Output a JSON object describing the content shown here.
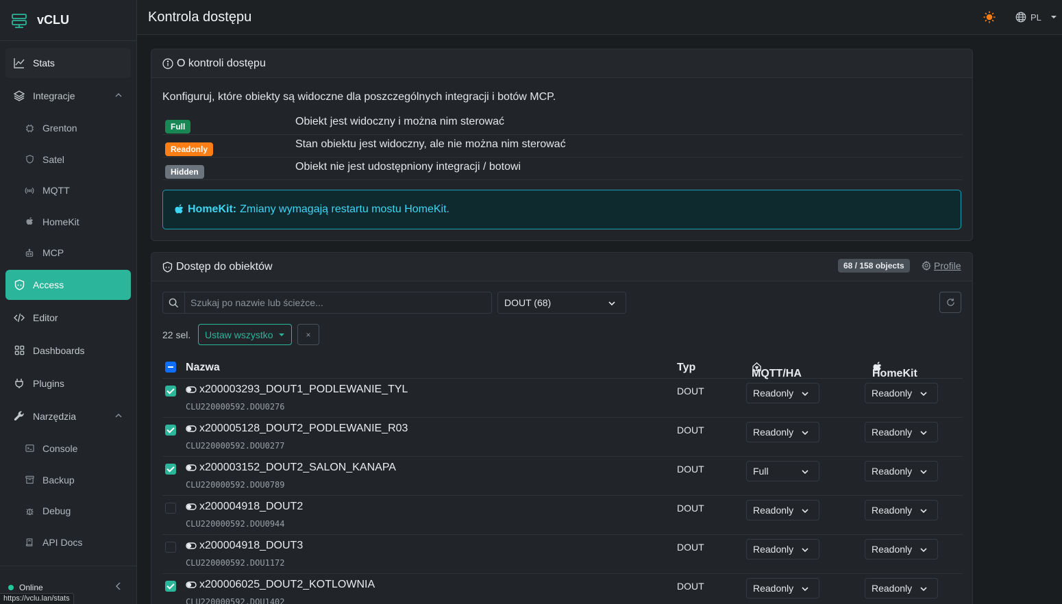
{
  "app": {
    "name": "vCLU"
  },
  "header": {
    "title": "Kontrola dostępu",
    "language": "PL"
  },
  "sidebar": {
    "stats": "Stats",
    "integrations": {
      "label": "Integracje",
      "items": [
        "Grenton",
        "Satel",
        "MQTT",
        "HomeKit",
        "MCP"
      ]
    },
    "access": "Access",
    "editor": "Editor",
    "dashboards": "Dashboards",
    "plugins": "Plugins",
    "tools": {
      "label": "Narzędzia",
      "items": [
        "Console",
        "Backup",
        "Debug",
        "API Docs"
      ]
    },
    "status": "Online",
    "url_tooltip": "https://vclu.lan/stats"
  },
  "about": {
    "title": "O kontroli dostępu",
    "intro": "Konfiguruj, które obiekty są widoczne dla poszczególnych integracji i botów MCP.",
    "levels": [
      {
        "badge": "Full",
        "desc": "Obiekt jest widoczny i można nim sterować"
      },
      {
        "badge": "Readonly",
        "desc": "Stan obiektu jest widoczny, ale nie można nim sterować"
      },
      {
        "badge": "Hidden",
        "desc": "Obiekt nie jest udostępniony integracji / botowi"
      }
    ],
    "alert": {
      "label": "HomeKit:",
      "text": "Zmiany wymagają restartu mostu HomeKit."
    },
    "colors": {
      "full": "#198754",
      "readonly": "#fd7e14",
      "hidden": "#6c757d",
      "accent": "#2bb59a"
    }
  },
  "objects": {
    "title": "Dostęp do obiektów",
    "count": "68 / 158 objects",
    "profile_link": "Profile",
    "search_placeholder": "Szukaj po nazwie lub ścieżce...",
    "type_filter": "DOUT (68)",
    "selected": "22 sel.",
    "set_all": "Ustaw wszystko",
    "clear": "×",
    "columns": {
      "name": "Nazwa",
      "type": "Typ",
      "mqtt": "MQTT/HA",
      "homekit": "HomeKit"
    },
    "rows": [
      {
        "checked": true,
        "name": "x200003293_DOUT1_PODLEWANIE_TYL",
        "path": "CLU220000592.DOU0276",
        "type": "DOUT",
        "mqtt": "Readonly",
        "homekit": "Readonly"
      },
      {
        "checked": true,
        "name": "x200005128_DOUT2_PODLEWANIE_R03",
        "path": "CLU220000592.DOU0277",
        "type": "DOUT",
        "mqtt": "Readonly",
        "homekit": "Readonly"
      },
      {
        "checked": true,
        "name": "x200003152_DOUT2_SALON_KANAPA",
        "path": "CLU220000592.DOU0789",
        "type": "DOUT",
        "mqtt": "Full",
        "homekit": "Readonly"
      },
      {
        "checked": false,
        "name": "x200004918_DOUT2",
        "path": "CLU220000592.DOU0944",
        "type": "DOUT",
        "mqtt": "Readonly",
        "homekit": "Readonly"
      },
      {
        "checked": false,
        "name": "x200004918_DOUT3",
        "path": "CLU220000592.DOU1172",
        "type": "DOUT",
        "mqtt": "Readonly",
        "homekit": "Readonly"
      },
      {
        "checked": true,
        "name": "x200006025_DOUT2_KOTLOWNIA",
        "path": "CLU220000592.DOU1402",
        "type": "DOUT",
        "mqtt": "Readonly",
        "homekit": "Readonly"
      }
    ]
  }
}
